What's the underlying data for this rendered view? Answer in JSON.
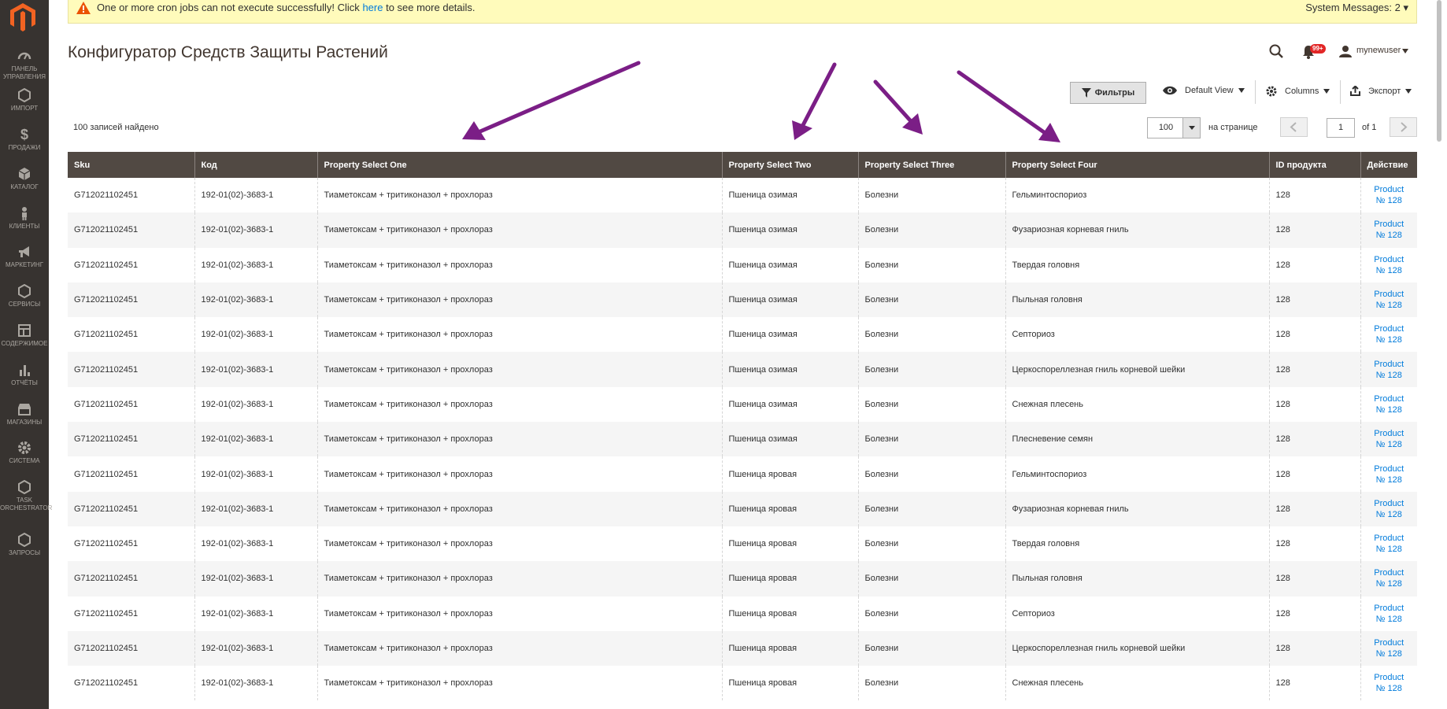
{
  "sidebar": {
    "items": [
      {
        "label": "ПАНЕЛЬ УПРАВЛЕНИЯ",
        "icon": "dashboard-icon"
      },
      {
        "label": "ИМПОРТ",
        "icon": "hexagon-icon"
      },
      {
        "label": "ПРОДАЖИ",
        "icon": "dollar-icon"
      },
      {
        "label": "КАТАЛОГ",
        "icon": "cube-icon"
      },
      {
        "label": "КЛИЕНТЫ",
        "icon": "person-icon"
      },
      {
        "label": "МАРКЕТИНГ",
        "icon": "megaphone-icon"
      },
      {
        "label": "СЕРВИСЫ",
        "icon": "hexagon-icon"
      },
      {
        "label": "СОДЕРЖИМОЕ",
        "icon": "layout-icon"
      },
      {
        "label": "ОТЧЁТЫ",
        "icon": "bar-chart-icon"
      },
      {
        "label": "МАГАЗИНЫ",
        "icon": "store-icon"
      },
      {
        "label": "СИСТЕМА",
        "icon": "gear-icon"
      },
      {
        "label": "TASK ORCHESTRATOR",
        "icon": "hexagon-icon"
      },
      {
        "label": "ЗАПРОСЫ",
        "icon": "hexagon-icon"
      }
    ]
  },
  "system_message": {
    "text_before": "One or more cron jobs can not execute successfully! Click ",
    "link": "here",
    "text_after": " to see more details.",
    "counter": "System Messages: 2"
  },
  "header": {
    "title": "Конфигуратор Средств Защиты Растений",
    "notification_badge": "99+",
    "user_name": "mynewuser"
  },
  "toolbar": {
    "filters_label": "Фильтры",
    "view_label": "Default View",
    "columns_label": "Columns",
    "export_label": "Экспорт",
    "records_found": "100 записей найдено",
    "per_page_value": "100",
    "per_page_label": "на странице",
    "page_value": "1",
    "page_of": "of 1"
  },
  "table": {
    "columns": [
      "Sku",
      "Код",
      "Property Select One",
      "Property Select Two",
      "Property Select Three",
      "Property Select Four",
      "ID продукта",
      "Действие"
    ],
    "rows": [
      [
        "G712021102451",
        "192-01(02)-3683-1",
        "Тиаметоксам + тритиконазол + прохлораз",
        "Пшеница озимая",
        "Болезни",
        "Гельминтоспориоз",
        "128",
        "Product № 128"
      ],
      [
        "G712021102451",
        "192-01(02)-3683-1",
        "Тиаметоксам + тритиконазол + прохлораз",
        "Пшеница озимая",
        "Болезни",
        "Фузариозная корневая гниль",
        "128",
        "Product № 128"
      ],
      [
        "G712021102451",
        "192-01(02)-3683-1",
        "Тиаметоксам + тритиконазол + прохлораз",
        "Пшеница озимая",
        "Болезни",
        "Твердая головня",
        "128",
        "Product № 128"
      ],
      [
        "G712021102451",
        "192-01(02)-3683-1",
        "Тиаметоксам + тритиконазол + прохлораз",
        "Пшеница озимая",
        "Болезни",
        "Пыльная головня",
        "128",
        "Product № 128"
      ],
      [
        "G712021102451",
        "192-01(02)-3683-1",
        "Тиаметоксам + тритиконазол + прохлораз",
        "Пшеница озимая",
        "Болезни",
        "Септориоз",
        "128",
        "Product № 128"
      ],
      [
        "G712021102451",
        "192-01(02)-3683-1",
        "Тиаметоксам + тритиконазол + прохлораз",
        "Пшеница озимая",
        "Болезни",
        "Церкоспореллезная гниль корневой шейки",
        "128",
        "Product № 128"
      ],
      [
        "G712021102451",
        "192-01(02)-3683-1",
        "Тиаметоксам + тритиконазол + прохлораз",
        "Пшеница озимая",
        "Болезни",
        "Снежная плесень",
        "128",
        "Product № 128"
      ],
      [
        "G712021102451",
        "192-01(02)-3683-1",
        "Тиаметоксам + тритиконазол + прохлораз",
        "Пшеница озимая",
        "Болезни",
        "Плесневение семян",
        "128",
        "Product № 128"
      ],
      [
        "G712021102451",
        "192-01(02)-3683-1",
        "Тиаметоксам + тритиконазол + прохлораз",
        "Пшеница яровая",
        "Болезни",
        "Гельминтоспориоз",
        "128",
        "Product № 128"
      ],
      [
        "G712021102451",
        "192-01(02)-3683-1",
        "Тиаметоксам + тритиконазол + прохлораз",
        "Пшеница яровая",
        "Болезни",
        "Фузариозная корневая гниль",
        "128",
        "Product № 128"
      ],
      [
        "G712021102451",
        "192-01(02)-3683-1",
        "Тиаметоксам + тритиконазол + прохлораз",
        "Пшеница яровая",
        "Болезни",
        "Твердая головня",
        "128",
        "Product № 128"
      ],
      [
        "G712021102451",
        "192-01(02)-3683-1",
        "Тиаметоксам + тритиконазол + прохлораз",
        "Пшеница яровая",
        "Болезни",
        "Пыльная головня",
        "128",
        "Product № 128"
      ],
      [
        "G712021102451",
        "192-01(02)-3683-1",
        "Тиаметоксам + тритиконазол + прохлораз",
        "Пшеница яровая",
        "Болезни",
        "Септориоз",
        "128",
        "Product № 128"
      ],
      [
        "G712021102451",
        "192-01(02)-3683-1",
        "Тиаметоксам + тритиконазол + прохлораз",
        "Пшеница яровая",
        "Болезни",
        "Церкоспореллезная гниль корневой шейки",
        "128",
        "Product № 128"
      ],
      [
        "G712021102451",
        "192-01(02)-3683-1",
        "Тиаметоксам + тритиконазол + прохлораз",
        "Пшеница яровая",
        "Болезни",
        "Снежная плесень",
        "128",
        "Product № 128"
      ]
    ]
  },
  "colors": {
    "sidebar_bg": "#373330",
    "header_row_bg": "#514943",
    "link": "#007bdb",
    "annotation_arrow": "#7b1e86",
    "message_bg": "#fffbbb"
  }
}
